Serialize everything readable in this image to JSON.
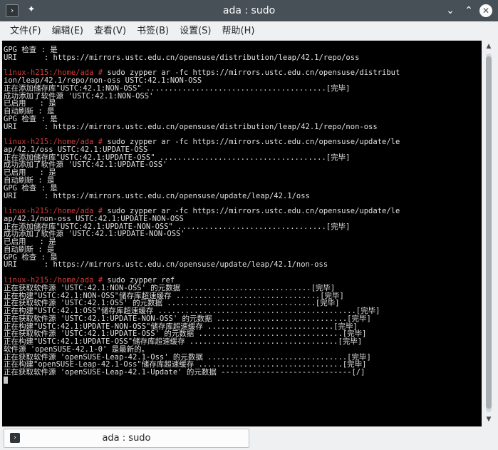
{
  "window": {
    "title": "ada : sudo",
    "app_icon": "terminal-icon",
    "pin_icon": "pin-icon",
    "minimize_glyph": "⌄",
    "maximize_glyph": "⌃",
    "close_glyph": "✕"
  },
  "menu": [
    {
      "label": "文件(F)"
    },
    {
      "label": "编辑(E)"
    },
    {
      "label": "查看(V)"
    },
    {
      "label": "书签(B)"
    },
    {
      "label": "设置(S)"
    },
    {
      "label": "帮助(H)"
    }
  ],
  "terminal": {
    "prompt_color": "#d33a3a",
    "lines": [
      {
        "text": "GPG 检查 : 是"
      },
      {
        "text": "URI      : https://mirrors.ustc.edu.cn/opensuse/distribution/leap/42.1/repo/oss"
      },
      {
        "text": ""
      },
      {
        "prompt": "linux-h215:/home/ada #",
        "text": " sudo zypper ar -fc https://mirrors.ustc.edu.cn/opensuse/distribut"
      },
      {
        "text": "ion/leap/42.1/repo/non-oss USTC:42.1:NON-OSS"
      },
      {
        "text": "正在添加储存库\"USTC:42.1:NON-OSS\" ........................................[完毕]"
      },
      {
        "text": "成功添加了软件源 'USTC:42.1:NON-OSS'"
      },
      {
        "text": "已启用   : 是"
      },
      {
        "text": "自动刷新 : 是"
      },
      {
        "text": "GPG 检查 : 是"
      },
      {
        "text": "URI      : https://mirrors.ustc.edu.cn/opensuse/distribution/leap/42.1/repo/non-oss"
      },
      {
        "text": ""
      },
      {
        "prompt": "linux-h215:/home/ada #",
        "text": " sudo zypper ar -fc https://mirrors.ustc.edu.cn/opensuse/update/le"
      },
      {
        "text": "ap/42.1/oss USTC:42.1:UPDATE-OSS"
      },
      {
        "text": "正在添加储存库\"USTC:42.1:UPDATE-OSS\" .....................................[完毕]"
      },
      {
        "text": "成功添加了软件源 'USTC:42.1:UPDATE-OSS'"
      },
      {
        "text": "已启用   : 是"
      },
      {
        "text": "自动刷新 : 是"
      },
      {
        "text": "GPG 检查 : 是"
      },
      {
        "text": "URI      : https://mirrors.ustc.edu.cn/opensuse/update/leap/42.1/oss"
      },
      {
        "text": ""
      },
      {
        "prompt": "linux-h215:/home/ada #",
        "text": " sudo zypper ar -fc https://mirrors.ustc.edu.cn/opensuse/update/le"
      },
      {
        "text": "ap/42.1/non-oss USTC:42.1:UPDATE-NON-OSS"
      },
      {
        "text": "正在添加储存库\"USTC:42.1:UPDATE-NON-OSS\" .................................[完毕]"
      },
      {
        "text": "成功添加了软件源 'USTC:42.1:UPDATE-NON-OSS'"
      },
      {
        "text": "已启用   : 是"
      },
      {
        "text": "自动刷新 : 是"
      },
      {
        "text": "GPG 检查 : 是"
      },
      {
        "text": "URI      : https://mirrors.ustc.edu.cn/opensuse/update/leap/42.1/non-oss"
      },
      {
        "text": ""
      },
      {
        "prompt": "linux-h215:/home/ada #",
        "text": " sudo zypper ref"
      },
      {
        "text": "正在获取软件源 'USTC:42.1:NON-OSS' 的元数据 ............................[完毕]"
      },
      {
        "text": "正在构建\"USTC:42.1:NON-OSS\"储存库超速缓存 ................................[完毕]"
      },
      {
        "text": "正在获取软件源 'USTC:42.1:OSS' 的元数据 .................................[完毕]"
      },
      {
        "text": "正在构建\"USTC:42.1:OSS\"储存库超速缓存 ............................................[完毕]"
      },
      {
        "text": "正在获取软件源 'USTC:42.1:UPDATE-NON-OSS' 的元数据 .............................[完毕]"
      },
      {
        "text": "正在构建\"USTC:42.1:UPDATE-NON-OSS\"储存库超速缓存 ............................[完毕]"
      },
      {
        "text": "正在获取软件源 'USTC:42.1:UPDATE-OSS' 的元数据 ................................[完毕]"
      },
      {
        "text": "正在构建\"USTC:42.1:UPDATE-OSS\"储存库超速缓存 .................................[完毕]"
      },
      {
        "text": "软件源 'openSUSE-42.1-0' 是最新的。"
      },
      {
        "text": "正在获取软件源 'openSUSE-Leap-42.1-Oss' 的元数据 ...............................[完毕]"
      },
      {
        "text": "正在构建\"openSUSE-Leap-42.1-Oss\"储存库超速缓存 ................................[完毕]"
      },
      {
        "text": "正在获取软件源 'openSUSE-Leap-42.1-Update' 的元数据 -----------------------------[/]"
      },
      {
        "cursor": true,
        "text": ""
      }
    ]
  },
  "scrollbar": {
    "up_glyph": "▲",
    "down_glyph": "▼"
  },
  "tabs": [
    {
      "label": "ada : sudo",
      "icon": "terminal-icon",
      "active": true
    }
  ]
}
